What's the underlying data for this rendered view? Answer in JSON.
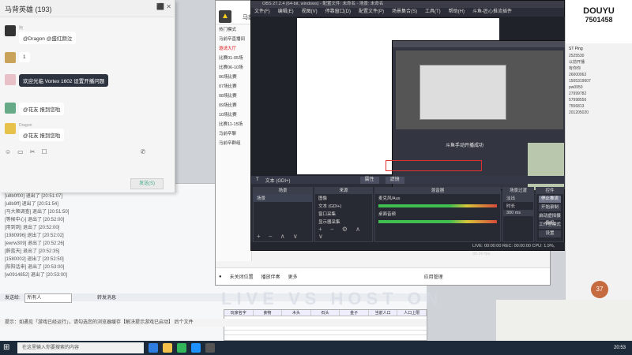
{
  "chat": {
    "title": "马背英雄 (193)",
    "messages": [
      {
        "sender": "阿",
        "text": "@Dragon @盛红颜泣"
      },
      {
        "sender": "",
        "text": "1"
      },
      {
        "sender": "",
        "text": "欢迎光临 Vortex 1602 设置开播问题"
      },
      {
        "sender": "",
        "text": "@花友 报到您啦"
      },
      {
        "sender": "Dragon",
        "text": "@花友 报到您啦"
      }
    ],
    "send_label": "发送(S)",
    "win_controls": "⬛ ✕"
  },
  "log_lines": [
    "[u8b0f00] 退出了 [20:51:07]",
    "[u8b9ff] 退出了 [20:51:54]",
    "[马大顺调查] 退出了 [20:51:50]",
    "[等候中心] 退出了 [20:52:00]",
    "[用到到] 退出了 [20:52:00]",
    "[1980996] 退出了 [20:52:02]",
    "[ewrw309] 退出了 [20:52:26]",
    "[蔚蓝天] 退出了 [20:52:35]",
    "[1580002] 退出了 [20:52:50]",
    "[阳阳话来] 退出了 [20:53:00]",
    "[w0914852] 退出了 [20:53:00]"
  ],
  "sheet_bar": {
    "label": "发送给:",
    "value": "所有人",
    "check": "转发消息"
  },
  "tip_text": "提示：如遇见「游戏已经运行」，请勾选您的浏览器缓存【解决提示游戏已启动】 后个文件",
  "grid_headers": [
    "玩家名字",
    "食物",
    "木头",
    "石头",
    "金子",
    "当前人口",
    "人口上限"
  ],
  "live": {
    "title": "马前卒",
    "sidebar": [
      "热门模式",
      "马前卒直播间",
      "邀请大厅",
      "比赛01-05场",
      "比赛06-10场",
      "06场比赛",
      "07场比赛",
      "08场比赛",
      "09场比赛",
      "10场比赛",
      "比赛11-15场",
      "马前卒聊",
      "马前卒群组"
    ],
    "bottom": [
      "未关闭位置",
      "播放伴奏",
      "更多",
      "应用管理"
    ]
  },
  "obs": {
    "title": "OBS 27.2.4 (64-bit, windows) - 配置文件: 未命名 - 场景: 未命名",
    "menu": [
      "文件(F)",
      "编辑(E)",
      "视图(V)",
      "停靠窗口(D)",
      "配置文件(P)",
      "场景集合(S)",
      "工具(T)",
      "帮助(H)",
      "斗鱼-匠心推流插件"
    ],
    "caption": "斗鱼手动开播成功",
    "source_bar": {
      "name": "文本 (GDI+)",
      "tabs": [
        "属性",
        "滤镜"
      ]
    },
    "scenes_title": "场景",
    "scenes": [
      "场景"
    ],
    "sources_title": "来源",
    "sources": [
      "图像",
      "文本 (GDI+)",
      "窗口采集",
      "显示器采集"
    ],
    "mixer_title": "混音器",
    "mixer": [
      {
        "name": "麦克风/Aux",
        "db": "0.0 dB"
      },
      {
        "name": "桌面音频",
        "db": "0.0 dB"
      }
    ],
    "transition_title": "场景过渡",
    "transition_value": "淡出",
    "duration_label": "时长",
    "duration_value": "300 ms",
    "controls_title": "控件",
    "controls": [
      "停止推流",
      "开始录制",
      "启动虚拟摄像机",
      "工作室模式",
      "设置",
      "退出"
    ],
    "status": "LIVE: 00:00:00  REC: 00:00:00  CPU: 1.9%, 30.00 fps"
  },
  "douyu": {
    "brand": "DOUYU",
    "room_number": "7501458",
    "list_header": "ST Ping",
    "list": [
      "2525530",
      "以前开播",
      "有你你",
      "26000062",
      "1505319607",
      "pw0950",
      "27999782",
      "57998556",
      "7556813",
      "201205020"
    ],
    "badge": "37"
  },
  "banner": "LIVE  VS  HOST  ON",
  "taskbar": {
    "search": "在这里输入你要搜索的内容",
    "time": "20:53"
  }
}
